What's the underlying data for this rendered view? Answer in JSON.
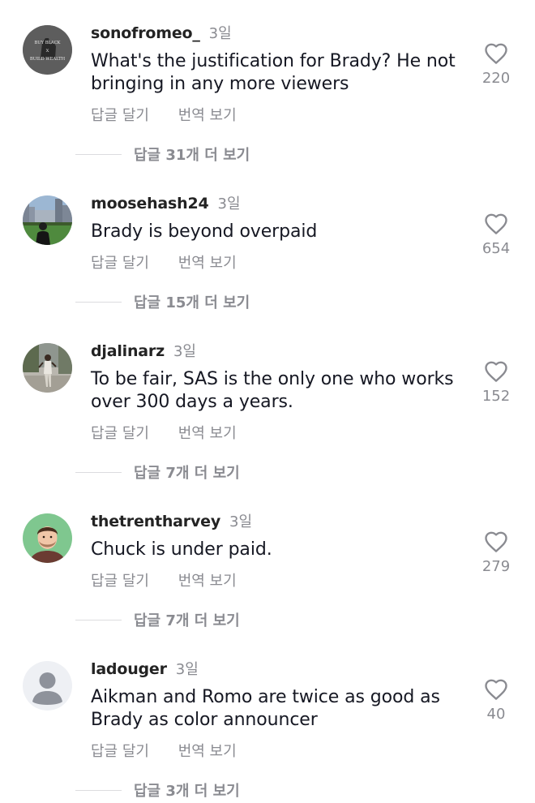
{
  "comments": [
    {
      "username": "sonofromeo_",
      "time": "3일",
      "text": "What's the justification for Brady?  He not bringing in any more viewers",
      "reply_label": "답글 달기",
      "translate_label": "번역 보기",
      "likes": "220",
      "view_replies": "답글 31개 더 보기",
      "avatar_text": [
        "BUY BLACK",
        "X",
        "BUILD WEALTH"
      ]
    },
    {
      "username": "moosehash24",
      "time": "3일",
      "text": "Brady is beyond overpaid",
      "reply_label": "답글 달기",
      "translate_label": "번역 보기",
      "likes": "654",
      "view_replies": "답글 15개 더 보기"
    },
    {
      "username": "djalinarz",
      "time": "3일",
      "text": "To be fair, SAS is the only one who works over 300 days a years.",
      "reply_label": "답글 달기",
      "translate_label": "번역 보기",
      "likes": "152",
      "view_replies": "답글 7개 더 보기"
    },
    {
      "username": "thetrentharvey",
      "time": "3일",
      "text": "Chuck is under paid.",
      "reply_label": "답글 달기",
      "translate_label": "번역 보기",
      "likes": "279",
      "view_replies": "답글 7개 더 보기"
    },
    {
      "username": "ladouger",
      "time": "3일",
      "text": "Aikman and Romo are twice as good as Brady as color announcer",
      "reply_label": "답글 달기",
      "translate_label": "번역 보기",
      "likes": "40",
      "view_replies": "답글 3개 더 보기"
    }
  ],
  "icons": {
    "like": "heart-outline-icon",
    "default_avatar": "default-user-avatar-icon"
  },
  "colors": {
    "text": "#161823",
    "secondary": "#8a8b91",
    "divider": "#dcdcdf"
  }
}
